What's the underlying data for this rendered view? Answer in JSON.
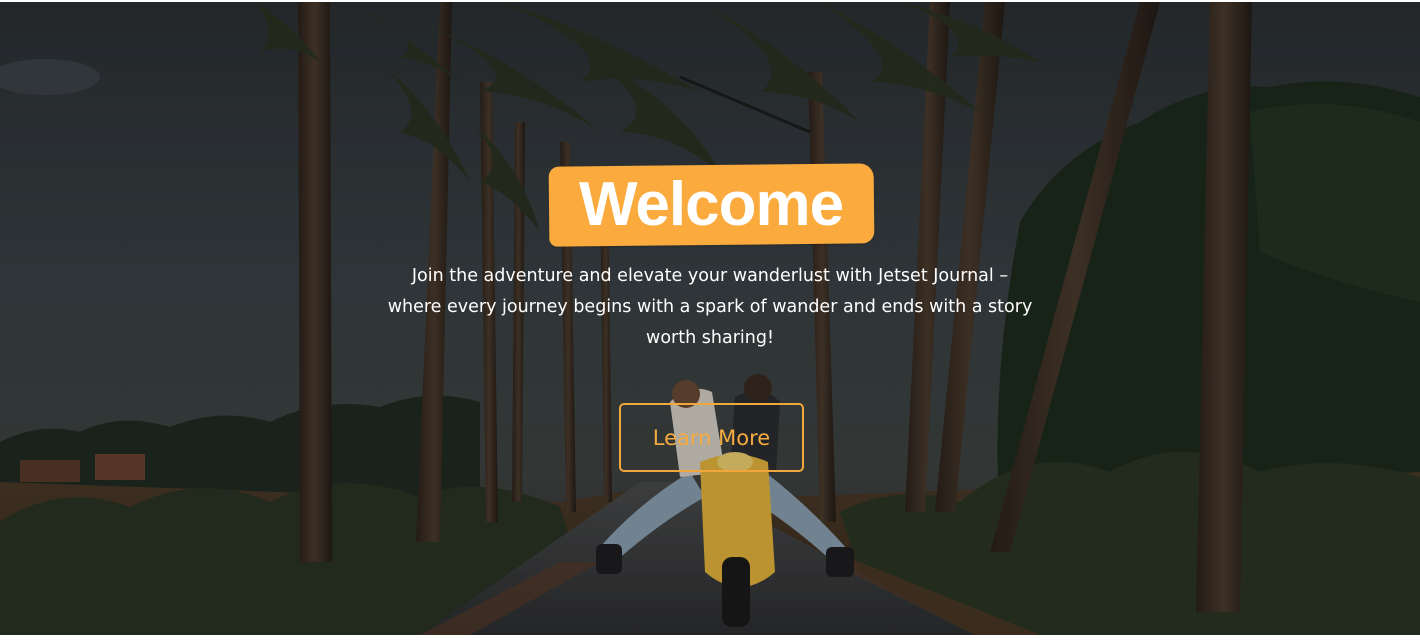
{
  "hero": {
    "title": "Welcome",
    "subtitle": "Join the adventure and elevate your wanderlust with Jetset Journal – where every journey begins with a spark of wander and ends with a story worth sharing!",
    "button_label": "Learn More",
    "background_image": "couple riding a yellow scooter down a palm-lined road"
  },
  "colors": {
    "accent": "#fbaa3e",
    "button_outline": "#f2a73c",
    "text": "#ffffff"
  }
}
